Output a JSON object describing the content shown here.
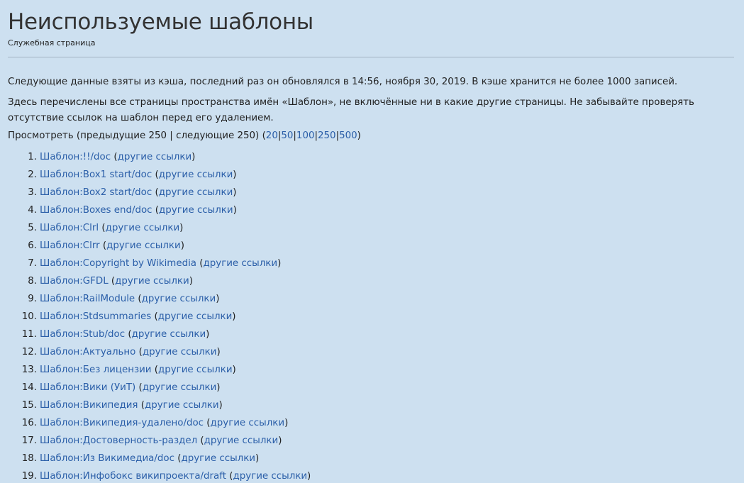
{
  "page": {
    "title": "Неиспользуемые шаблоны",
    "subtitle": "Служебная страница"
  },
  "paragraphs": {
    "cache_notice": "Следующие данные взяты из кэша, последний раз он обновлялся в 14:56, ноября 30, 2019. В кэше хранится не более 1000 записей.",
    "description": "Здесь перечислены все страницы пространства имён «Шаблон», не включённые ни в какие другие страницы. Не забывайте проверять отсутствие ссылок на шаблон перед его удалением."
  },
  "pagination": {
    "view_label": "Просмотреть",
    "prev": "(предыдущие 250",
    "sep": "|",
    "next": "следующие 250)",
    "open": "(",
    "close": ")",
    "limits": [
      "20",
      "50",
      "100",
      "250",
      "500"
    ]
  },
  "other_links_label": "другие ссылки",
  "templates": [
    {
      "num": "1.",
      "name": "Шаблон:!!/doc"
    },
    {
      "num": "2.",
      "name": "Шаблон:Box1 start/doc"
    },
    {
      "num": "3.",
      "name": "Шаблон:Box2 start/doc"
    },
    {
      "num": "4.",
      "name": "Шаблон:Boxes end/doc"
    },
    {
      "num": "5.",
      "name": "Шаблон:Clrl"
    },
    {
      "num": "6.",
      "name": "Шаблон:Clrr"
    },
    {
      "num": "7.",
      "name": "Шаблон:Copyright by Wikimedia"
    },
    {
      "num": "8.",
      "name": "Шаблон:GFDL"
    },
    {
      "num": "9.",
      "name": "Шаблон:RailModule"
    },
    {
      "num": "10.",
      "name": "Шаблон:Stdsummaries"
    },
    {
      "num": "11.",
      "name": "Шаблон:Stub/doc"
    },
    {
      "num": "12.",
      "name": "Шаблон:Актуально"
    },
    {
      "num": "13.",
      "name": "Шаблон:Без лицензии"
    },
    {
      "num": "14.",
      "name": "Шаблон:Вики (УиТ)"
    },
    {
      "num": "15.",
      "name": "Шаблон:Википедия"
    },
    {
      "num": "16.",
      "name": "Шаблон:Википедия-удалено/doc"
    },
    {
      "num": "17.",
      "name": "Шаблон:Достоверность-раздел"
    },
    {
      "num": "18.",
      "name": "Шаблон:Из Викимедиа/doc"
    },
    {
      "num": "19.",
      "name": "Шаблон:Инфобокс википроекта/draft"
    }
  ],
  "colors": {
    "background": "#cde0f0",
    "link": "#2a5ea8",
    "text": "#222222"
  }
}
